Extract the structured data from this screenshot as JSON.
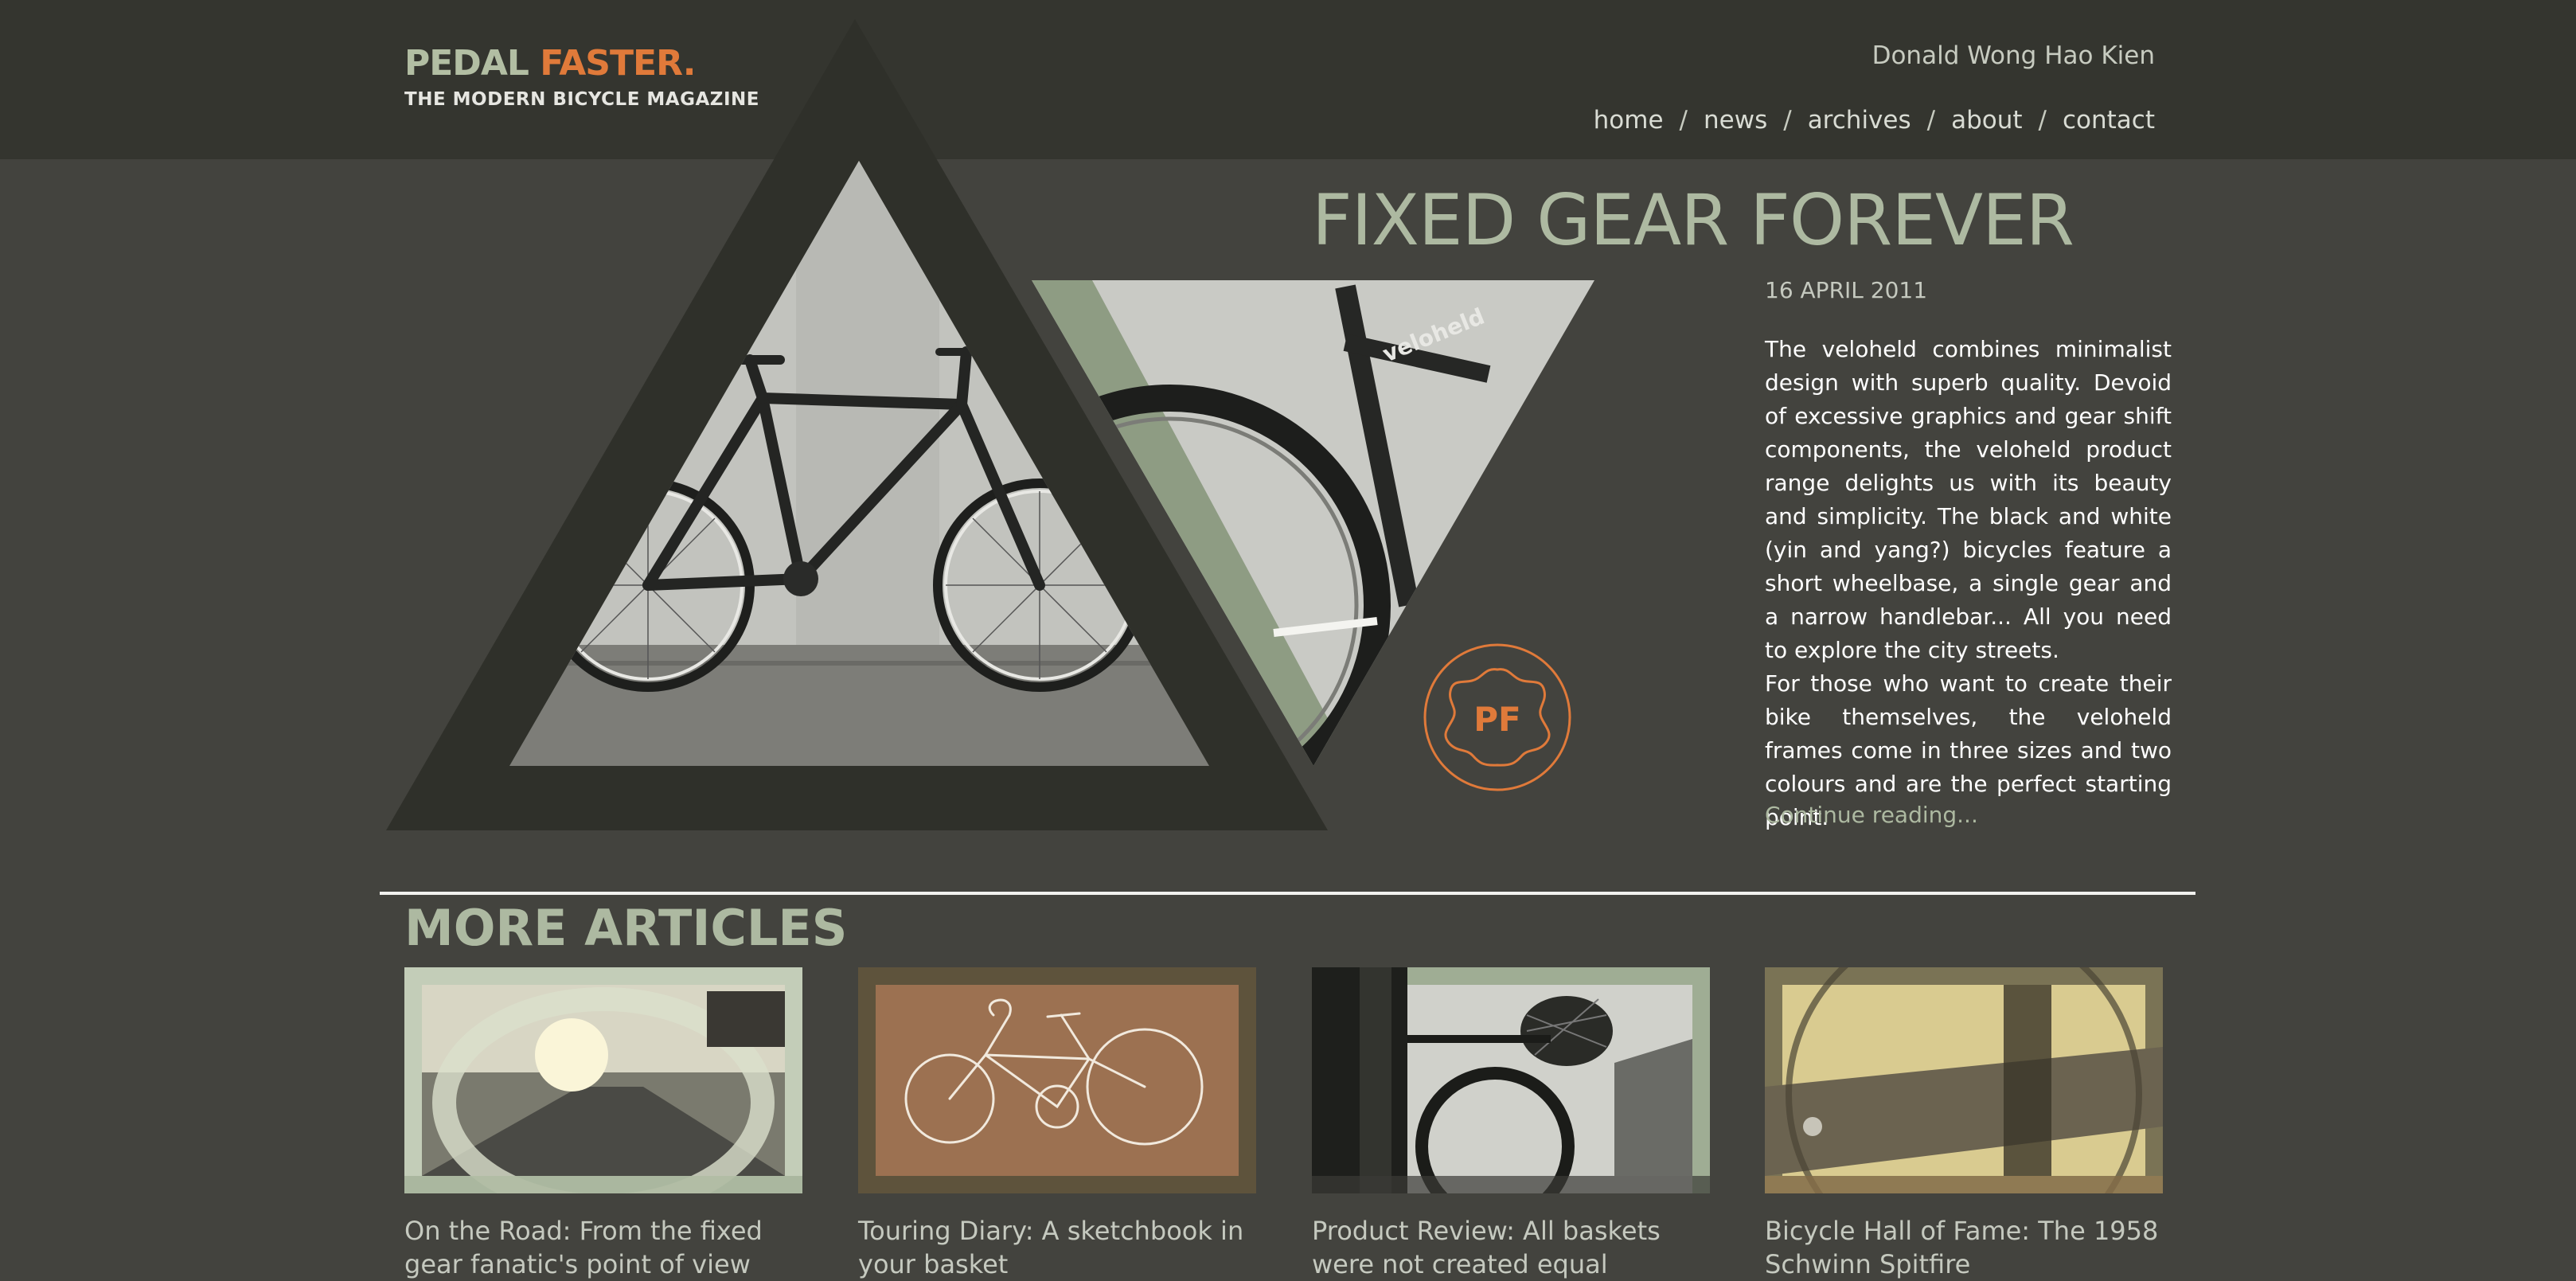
{
  "header": {
    "logo_primary": "PEDAL",
    "logo_accent": "FASTER.",
    "tagline": "THE MODERN BICYCLE MAGAZINE",
    "user_name": "Donald Wong Hao Kien",
    "nav": [
      "home",
      "news",
      "archives",
      "about",
      "contact"
    ],
    "nav_separator": "/"
  },
  "featured": {
    "title": "FIXED GEAR FOREVER",
    "date": "16 APRIL 2011",
    "paragraphs": [
      "The veloheld combines minimalist design with superb quality. Devoid of excessive graphics and gear shift components, the veloheld product range delights us with its beauty and simplicity. The black and white (yin and yang?) bicycles feature a short wheelbase, a single gear and a narrow handlebar... All you need to explore the city streets.",
      "For those who want to create their bike themselves, the veloheld frames come in three sizes and two colours and are the perfect starting point."
    ],
    "continue_label": "Continue reading...",
    "badge_text": "PF",
    "frame_text": "veloheld"
  },
  "more": {
    "heading": "MORE ARTICLES",
    "articles": [
      {
        "title": "On the Road: From the fixed gear fanatic's point of view"
      },
      {
        "title": "Touring Diary: A sketchbook in your basket"
      },
      {
        "title": "Product Review: All baskets were not created equal"
      },
      {
        "title": "Bicycle Hall of Fame: The 1958 Schwinn Spitfire"
      }
    ]
  },
  "colors": {
    "background": "#43433e",
    "header": "#34352f",
    "accent_orange": "#e07a3a",
    "sage": "#adb9a1"
  }
}
